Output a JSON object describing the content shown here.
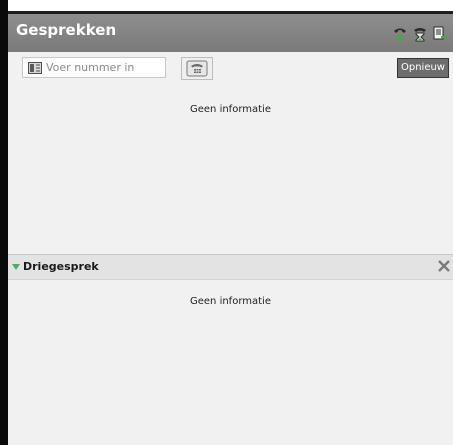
{
  "header": {
    "title": "Gesprekken",
    "icons": [
      "phone-green-icon",
      "hourglass-icon",
      "notes-icon"
    ]
  },
  "toolbar": {
    "search_placeholder": "Voer nummer in",
    "search_value": "",
    "dial_icon": "phone-keypad-icon",
    "retry_label": "Opnieuw"
  },
  "calls": {
    "empty_text": "Geen informatie"
  },
  "conference": {
    "title": "Driegesprek",
    "expanded": true,
    "empty_text": "Geen informatie"
  },
  "colors": {
    "header_bg": "#858585",
    "panel_bg": "#f1f1f1",
    "accent_green": "#4ab05a",
    "retry_bg": "#6d6d6d"
  }
}
